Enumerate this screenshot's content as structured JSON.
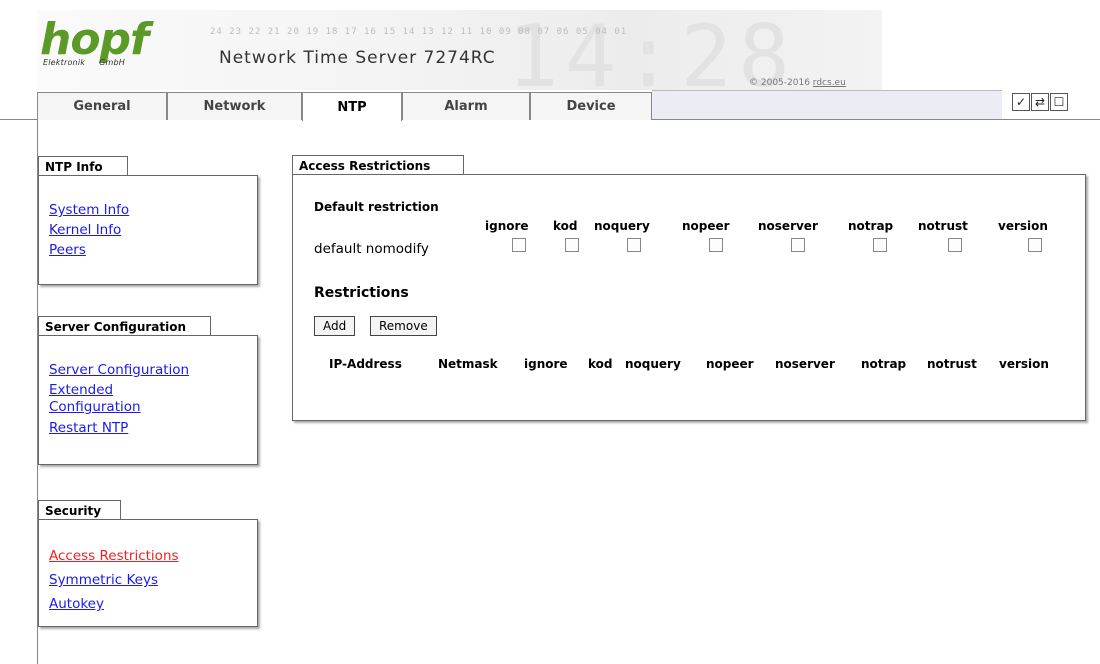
{
  "header": {
    "logo_text": "hopf",
    "logo_sub_left": "Elektronik",
    "logo_sub_right": "GmbH",
    "product_title": "Network Time Server 7274RC",
    "copyright_prefix": "© 2005-2016",
    "copyright_link": "rdcs.eu",
    "banner_numbers": "24 23 22 21 20 19 18 17 16 15 14 13 12 11 10 09 08 07 06 05 04 01",
    "banner_clock": "14:28"
  },
  "tabs": [
    {
      "label": "General"
    },
    {
      "label": "Network"
    },
    {
      "label": "NTP"
    },
    {
      "label": "Alarm"
    },
    {
      "label": "Device"
    }
  ],
  "active_tab": "NTP",
  "toolbar": {
    "apply_icon": "✓",
    "reload_icon": "⇄",
    "save_icon": "☐"
  },
  "sidebar": {
    "ntp_info": {
      "title": "NTP Info",
      "items": [
        {
          "label": "System Info"
        },
        {
          "label": "Kernel Info"
        },
        {
          "label": "Peers"
        }
      ]
    },
    "server_config": {
      "title": "Server Configuration",
      "items": [
        {
          "label": "Server Configuration"
        },
        {
          "label": "Extended"
        },
        {
          "label": "Configuration"
        },
        {
          "label": "Restart NTP"
        }
      ]
    },
    "security": {
      "title": "Security",
      "items": [
        {
          "label": "Access Restrictions"
        },
        {
          "label": "Symmetric Keys"
        },
        {
          "label": "Autokey"
        }
      ]
    }
  },
  "access_restrictions": {
    "title": "Access Restrictions",
    "default_restriction_label": "Default restriction",
    "default_value": "default nomodify",
    "flags": [
      "ignore",
      "kod",
      "noquery",
      "nopeer",
      "noserver",
      "notrap",
      "notrust",
      "version"
    ],
    "default_checked": [
      false,
      false,
      false,
      false,
      false,
      false,
      false,
      false
    ],
    "restrictions_title": "Restrictions",
    "add_label": "Add",
    "remove_label": "Remove",
    "table_headers": [
      "IP-Address",
      "Netmask",
      "ignore",
      "kod",
      "noquery",
      "nopeer",
      "noserver",
      "notrap",
      "notrust",
      "version"
    ],
    "rows": []
  }
}
